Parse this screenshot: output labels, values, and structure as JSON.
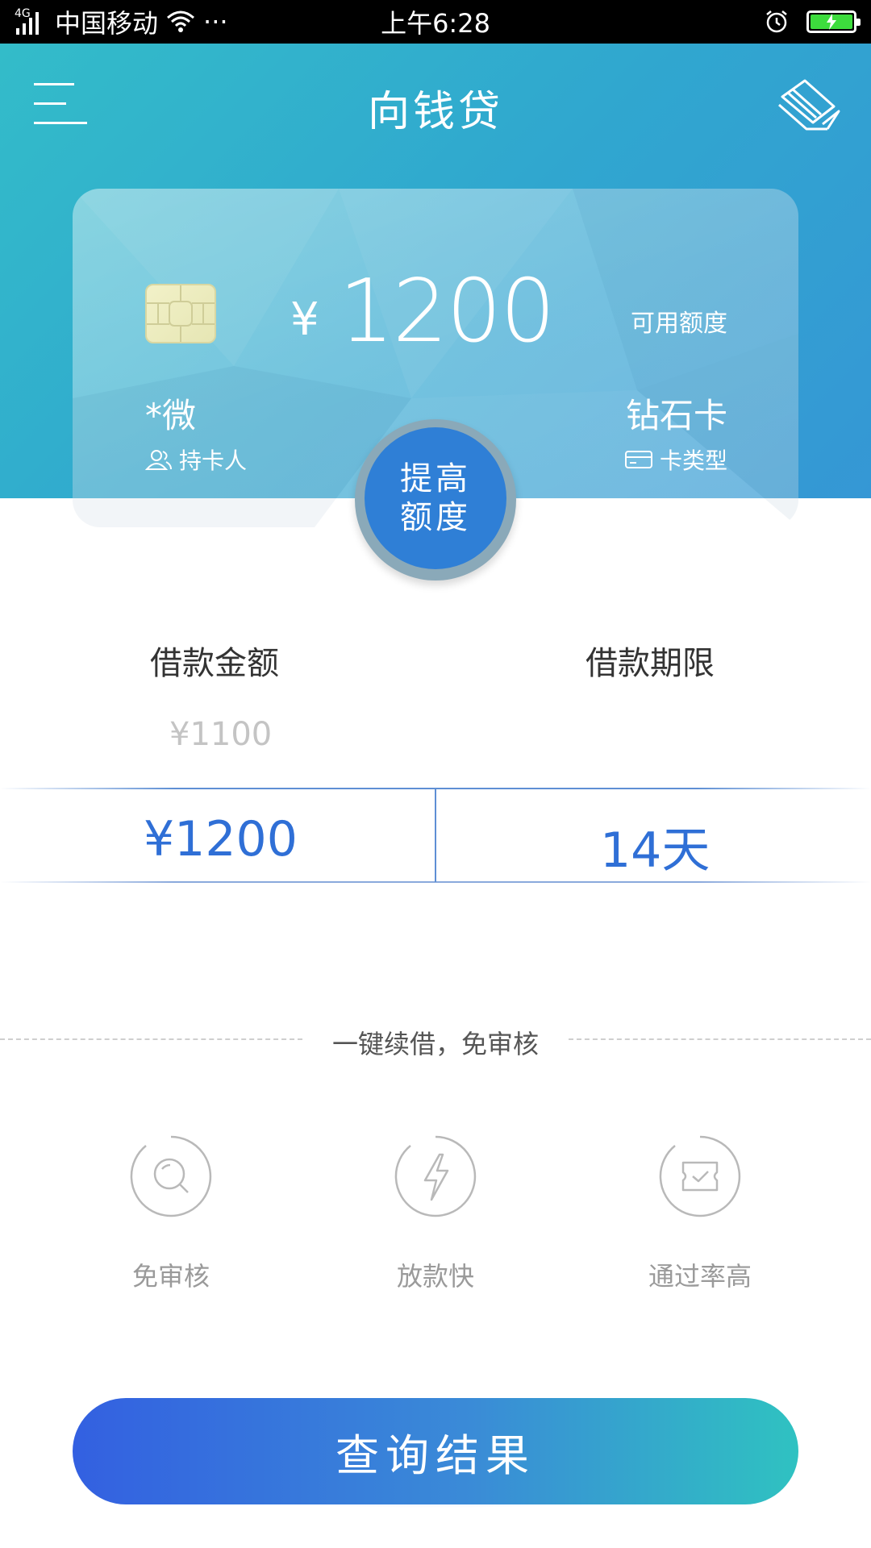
{
  "status_bar": {
    "network": "4G",
    "carrier": "中国移动",
    "more": "···",
    "time": "上午6:28"
  },
  "header": {
    "title": "向钱贷"
  },
  "card": {
    "currency_symbol": "¥",
    "amount": "1200",
    "available_label": "可用额度",
    "holder_name": "*微",
    "holder_label": "持卡人",
    "card_type": "钻石卡",
    "card_type_label": "卡类型"
  },
  "raise_button": {
    "line1": "提高",
    "line2": "额度"
  },
  "loan": {
    "amount_label": "借款金额",
    "term_label": "借款期限",
    "prev_amount": "¥1100",
    "selected_amount": "¥1200",
    "selected_term": "14天"
  },
  "divider": {
    "text": "一键续借，免审核"
  },
  "features": [
    {
      "label": "免审核",
      "icon": "search-icon"
    },
    {
      "label": "放款快",
      "icon": "lightning-icon"
    },
    {
      "label": "通过率高",
      "icon": "ticket-check-icon"
    }
  ],
  "query_button": {
    "label": "查询结果"
  },
  "colors": {
    "primary_blue": "#2f6fd6",
    "header_teal": "#33bcc9",
    "button_start": "#3360e1",
    "button_end": "#2fc2c1",
    "battery_green": "#3ddc3d"
  }
}
